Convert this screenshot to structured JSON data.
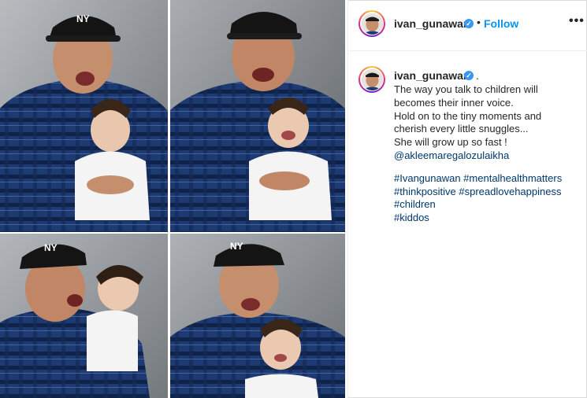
{
  "header": {
    "username": "ivan_gunawan",
    "verified_mark": "✓",
    "separator": "•",
    "follow_label": "Follow",
    "more_label": "•••",
    "avatar_icon": "profile-avatar-icon"
  },
  "caption": {
    "username": "ivan_gunawan",
    "trailing": ".",
    "lines": [
      "The way you talk to children will",
      "becomes their inner voice.",
      "Hold on to the tiny moments and",
      "cherish every little snuggles...",
      "She will grow up so fast !"
    ],
    "mention": "@akleemaregalozulaikha",
    "hashtags": [
      "#Ivangunawan #mentalhealthmatters",
      "#thinkpositive #spreadlovehappiness",
      "#children",
      "#kiddos"
    ]
  },
  "colors": {
    "follow": "#0095f6",
    "link": "#00376b",
    "verified": "#3897f0",
    "shirt": "#1f3f7a",
    "background": "#8a8f94"
  }
}
